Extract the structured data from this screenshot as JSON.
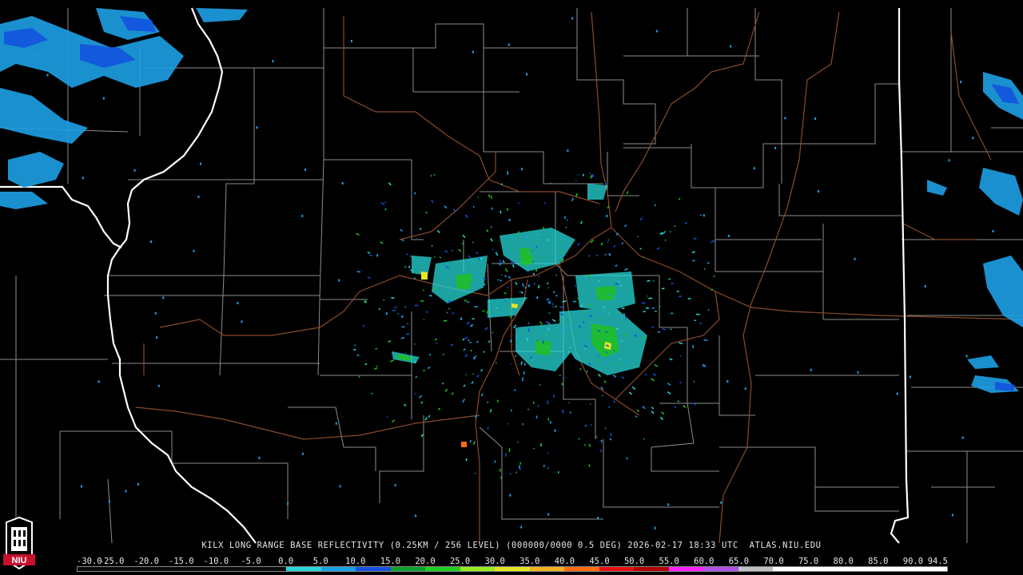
{
  "product": {
    "caption": "KILX LONG RANGE BASE REFLECTIVITY (0.25KM / 256 LEVEL) (000000/0000 0.5 DEG) 2026-02-17 18:33 UTC  ATLAS.NIU.EDU",
    "logo_text": "NIU"
  },
  "map": {
    "radar_site": "KILX",
    "background": "#000000",
    "state_border_color": "#ffffff",
    "county_line_color": "#8c8c8c",
    "highway_color": "#8b4a2b"
  },
  "colorscale": {
    "labels": [
      "-30.0",
      "-25.0",
      "-20.0",
      "-15.0",
      "-10.0",
      "-5.0",
      "0.0",
      "5.0",
      "10.0",
      "15.0",
      "20.0",
      "25.0",
      "30.0",
      "35.0",
      "40.0",
      "45.0",
      "50.0",
      "55.0",
      "60.0",
      "65.0",
      "70.0",
      "75.0",
      "80.0",
      "85.0",
      "90.0",
      "94.5"
    ],
    "colors": [
      "#0a0a0a",
      "#0a0a0a",
      "#0a0a0a",
      "#0a0a0a",
      "#0a0a0a",
      "#0a0a0a",
      "#27d8d8",
      "#19a2e6",
      "#1250e0",
      "#0a9e2a",
      "#20d020",
      "#9aea20",
      "#e6e620",
      "#f2b020",
      "#ff6a10",
      "#e61010",
      "#b00000",
      "#ff20ff",
      "#b050e6",
      "#c0c0c0",
      "#ffffff",
      "#ffffff",
      "#ffffff",
      "#ffffff",
      "#ffffff"
    ]
  }
}
